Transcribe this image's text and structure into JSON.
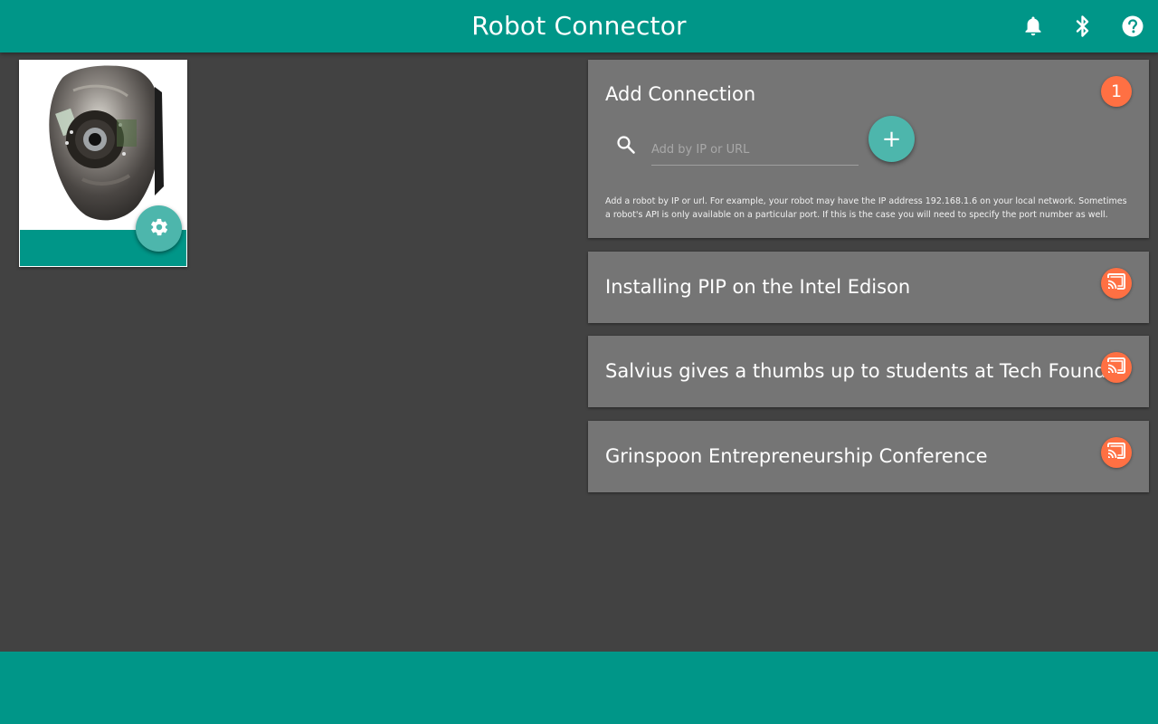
{
  "app_bar": {
    "title": "Robot Connector",
    "icons": [
      "bell-icon",
      "bluetooth-icon",
      "help-icon"
    ]
  },
  "robot": {
    "image": "robot-head-photo",
    "settings_icon": "gear-icon"
  },
  "add_connection": {
    "title": "Add Connection",
    "count": "1",
    "search_placeholder": "Add by IP or URL",
    "search_value": "",
    "add_label": "+",
    "help_text": "Add a robot by IP or url. For example, your robot may have the IP address 192.168.1.6 on your local network. Sometimes a robot's API is only available on a particular port. If this is the case you will need to specify the port number as well."
  },
  "posts": [
    {
      "title": "Installing PIP on the Intel Edison",
      "icon": "cast-icon"
    },
    {
      "title": "Salvius gives a thumbs up to students at Tech Foundry",
      "icon": "cast-icon"
    },
    {
      "title": "Grinspoon Entrepreneurship Conference",
      "icon": "cast-icon"
    }
  ],
  "colors": {
    "primary": "#009688",
    "accent_fab": "#4db6ac",
    "badge": "#ff7043",
    "background": "#424242",
    "card": "#757575"
  }
}
